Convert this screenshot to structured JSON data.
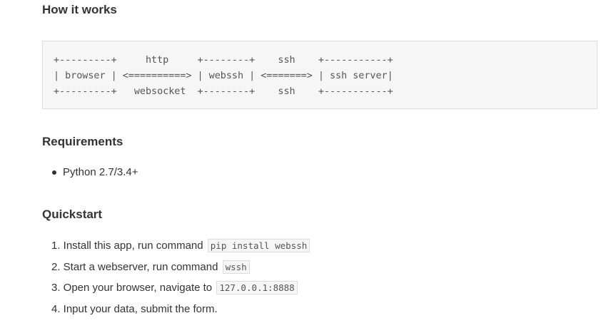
{
  "sections": {
    "how_it_works": {
      "heading": "How it works",
      "diagram": "+---------+     http     +--------+    ssh    +-----------+\n| browser | <==========> | webssh | <=======> | ssh server|\n+---------+   websocket  +--------+    ssh    +-----------+"
    },
    "requirements": {
      "heading": "Requirements",
      "items": [
        "Python 2.7/3.4+"
      ]
    },
    "quickstart": {
      "heading": "Quickstart",
      "steps": [
        {
          "text": "1. Install this app, run command",
          "code": "pip install webssh"
        },
        {
          "text": "2. Start a webserver, run command",
          "code": "wssh"
        },
        {
          "text": "3. Open your browser, navigate to",
          "code": "127.0.0.1:8888"
        },
        {
          "text": "4. Input your data, submit the form.",
          "code": ""
        }
      ]
    }
  }
}
